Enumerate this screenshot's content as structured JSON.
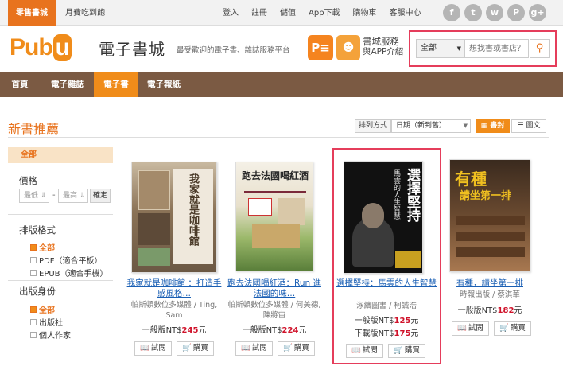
{
  "topbar": {
    "zero_tab": "零售書城",
    "sub_store": "月費吃到飽",
    "links": [
      "登入",
      "註冊",
      "儲值",
      "App下載",
      "購物車",
      "客服中心"
    ],
    "social_icons": [
      "facebook-icon",
      "twitter-icon",
      "weibo-icon",
      "plurk-icon",
      "google-plus-icon"
    ],
    "social_glyphs": [
      "f",
      "t",
      "w",
      "P",
      "g+"
    ]
  },
  "header": {
    "logo_text": "Pub",
    "logo_u": "u",
    "logo_cn": "電子書城",
    "slogan": "最受歡迎的電子書、雜誌服務平台",
    "pe_label": "P≡",
    "app_line1": "書城服務",
    "app_line2": "與APP介紹"
  },
  "search": {
    "select_value": "全部",
    "placeholder": "想找書或書店？",
    "button_glyph": "⚲"
  },
  "nav": {
    "items": [
      "首頁",
      "電子雜誌",
      "電子書",
      "電子報紙"
    ],
    "active_index": 2
  },
  "main": {
    "title": "新書推薦",
    "sort_label": "排列方式",
    "sort_value": "日期（新到舊）",
    "view_cover": "書封",
    "view_list": "圖文"
  },
  "sidebar": {
    "all_label": "全部",
    "price_heading": "價格",
    "price_min_placeholder": "最低",
    "price_sep": "-",
    "price_max_placeholder": "最高",
    "price_ok": "確定",
    "format_heading": "排版格式",
    "format_options": [
      "全部",
      "PDF（適合平板）",
      "EPUB（適合手機）"
    ],
    "identity_heading": "出版身份",
    "identity_options": [
      "全部",
      "出版社",
      "個人作家"
    ]
  },
  "books": [
    {
      "title": "我家就是咖啡館 ：打造手感風格…",
      "publisher": "帕斯頓數位多媒體 / Ting, Sam",
      "price_label": "一般版NT$",
      "price": "245",
      "price_unit": "元",
      "trial": "試閱",
      "buy": "購買",
      "cover_text": "我家就是咖啡館"
    },
    {
      "title": "跑去法國喝紅酒：Run 進法國的味…",
      "publisher": "帕斯頓數位多媒體 / 何美德, 陳將宙",
      "price_label": "一般版NT$",
      "price": "224",
      "price_unit": "元",
      "trial": "試閱",
      "buy": "購買",
      "cover_text": "跑去法國喝紅酒"
    },
    {
      "title": "選擇堅持：馬雲的人生智慧",
      "publisher": "泳續圖書 / 柯誠浩",
      "price_label": "一般版NT$",
      "price": "125",
      "price_unit": "元",
      "price2_label": "下載版NT$",
      "price2": "175",
      "price2_unit": "元",
      "trial": "試閱",
      "buy": "購買",
      "cover_text": "選擇堅持",
      "cover_sub": "馬雲的人生智慧"
    },
    {
      "title": "有種，請坐第一排",
      "publisher": "時報出版 / 蔡淇華",
      "price_label": "一般版NT$",
      "price": "182",
      "price_unit": "元",
      "trial": "試閱",
      "buy": "購買",
      "cover_text": "有種",
      "cover_sub": "請坐第一排"
    }
  ],
  "colors": {
    "accent": "#f08c1a",
    "nav_bg": "#7b5a43",
    "highlight": "#e53d5b",
    "price": "#d0122a",
    "link": "#1a5fb4"
  }
}
